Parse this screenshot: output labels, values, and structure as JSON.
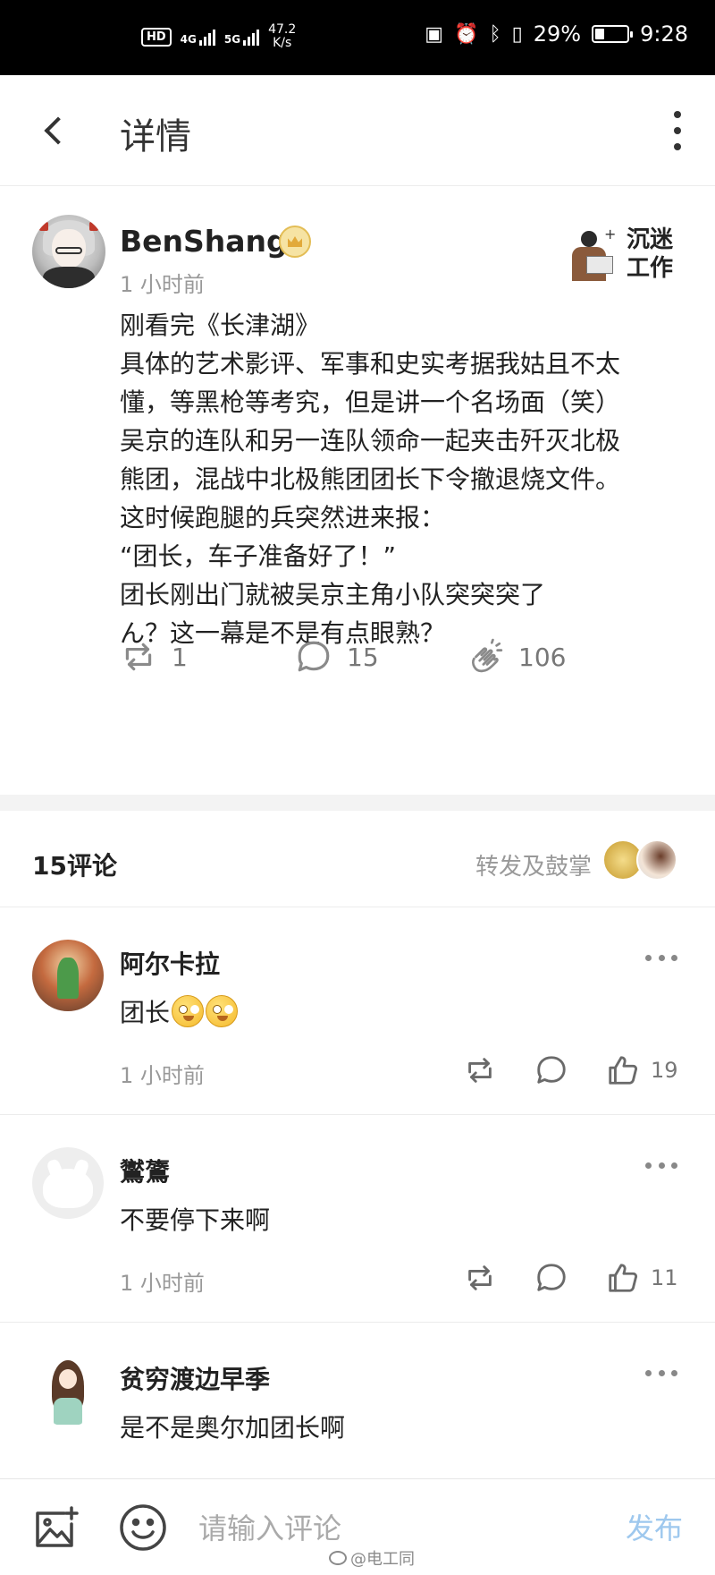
{
  "status_bar": {
    "hd": "HD",
    "net1": "4G",
    "net2": "5G",
    "speed_value": "47.2",
    "speed_unit": "K/s",
    "battery_percent": "29%",
    "battery_level": 0.29,
    "time": "9:28",
    "icons": [
      "nfc-icon",
      "alarm-icon",
      "bluetooth-icon",
      "vibrate-icon"
    ]
  },
  "header": {
    "title": "详情",
    "back_icon": "chevron-left-icon",
    "more_icon": "more-vertical-icon"
  },
  "post": {
    "author": "BenShang",
    "badge_icon": "crown-badge-icon",
    "time": "1 小时前",
    "brand_text": "沉迷工作",
    "lines": [
      "刚看完《长津湖》",
      "具体的艺术影评、军事和史实考据我姑且不太",
      "懂，等黑枪等考究，但是讲一个名场面（笑）",
      "吴京的连队和另一连队领命一起夹击歼灭北极",
      "熊团，混战中北极熊团团长下令撤退烧文件。",
      "这时候跑腿的兵突然进来报：",
      "“团长，车子准备好了！”",
      "团长刚出门就被吴京主角小队突突突了",
      "ん？这一幕是不是有点眼熟？"
    ],
    "repost_count": "1",
    "comment_count": "15",
    "clap_count": "106"
  },
  "comments_header": {
    "count_label": "15评论",
    "forward_label": "转发及鼓掌"
  },
  "comments": [
    {
      "name": "阿尔卡拉",
      "text": "团长",
      "emoji_count": 2,
      "time": "1 小时前",
      "likes": "19"
    },
    {
      "name": "鸑鷟",
      "text": "不要停下来啊",
      "emoji_count": 0,
      "time": "1 小时前",
      "likes": "11"
    },
    {
      "name": "贫穷渡边早季",
      "text": "是不是奥尔加团长啊",
      "emoji_count": 0,
      "time": "",
      "likes": ""
    }
  ],
  "input_bar": {
    "placeholder": "请输入评论",
    "publish_label": "发布"
  },
  "watermark": "@电工同",
  "colors": {
    "accent_disabled": "#9ec8ee",
    "text_primary": "#222222",
    "text_secondary": "#999999",
    "status_bar_bg": "#000000"
  }
}
